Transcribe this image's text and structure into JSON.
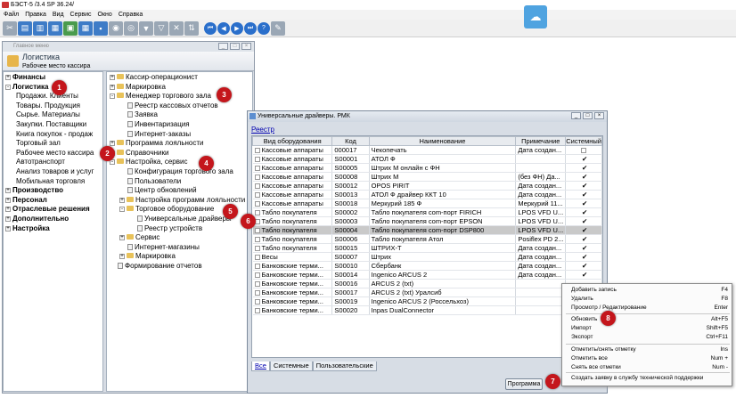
{
  "window": {
    "title": "БЭСТ-5 /3.4 SP 36.24/"
  },
  "menu": [
    "Файл",
    "Правка",
    "Вид",
    "Сервис",
    "Окно",
    "Справка"
  ],
  "main_window": {
    "caption": "Главное меню",
    "title": "Логистика",
    "subtitle": "Рабочее место кассира"
  },
  "left_tree": [
    {
      "label": "Финансы",
      "bold": true,
      "exp": "+"
    },
    {
      "label": "Логистика",
      "bold": true,
      "exp": "-"
    },
    {
      "label": "Продажи. Клиенты",
      "bold": false,
      "exp": ""
    },
    {
      "label": "Товары. Продукция",
      "bold": false,
      "exp": ""
    },
    {
      "label": "Сырье. Материалы",
      "bold": false,
      "exp": ""
    },
    {
      "label": "Закупки. Поставщики",
      "bold": false,
      "exp": ""
    },
    {
      "label": "Книга покупок - продаж",
      "bold": false,
      "exp": ""
    },
    {
      "label": "Торговый зал",
      "bold": false,
      "exp": ""
    },
    {
      "label": "Рабочее место кассира",
      "bold": false,
      "exp": ""
    },
    {
      "label": "Автотранспорт",
      "bold": false,
      "exp": ""
    },
    {
      "label": "Анализ товаров и услуг",
      "bold": false,
      "exp": ""
    },
    {
      "label": "Мобильная торговля",
      "bold": false,
      "exp": ""
    },
    {
      "label": "Производство",
      "bold": true,
      "exp": "+"
    },
    {
      "label": "Персонал",
      "bold": true,
      "exp": "+"
    },
    {
      "label": "Отраслевые решения",
      "bold": true,
      "exp": "+"
    },
    {
      "label": "Дополнительно",
      "bold": true,
      "exp": "+"
    },
    {
      "label": "Настройка",
      "bold": true,
      "exp": "+"
    }
  ],
  "mid_tree": [
    {
      "label": "Кассир-операционист",
      "type": "folder",
      "exp": "+",
      "level": 0
    },
    {
      "label": "Маркировка",
      "type": "folder",
      "exp": "+",
      "level": 0
    },
    {
      "label": "Менеджер торгового зала",
      "type": "folder",
      "exp": "-",
      "level": 0
    },
    {
      "label": "Реестр кассовых отчетов",
      "type": "doc",
      "exp": "",
      "level": 1
    },
    {
      "label": "Заявка",
      "type": "doc",
      "exp": "",
      "level": 1
    },
    {
      "label": "Инвентаризация",
      "type": "doc",
      "exp": "",
      "level": 1
    },
    {
      "label": "Интернет-заказы",
      "type": "doc",
      "exp": "",
      "level": 1
    },
    {
      "label": "Программа лояльности",
      "type": "folder",
      "exp": "+",
      "level": 0
    },
    {
      "label": "Справочники",
      "type": "folder",
      "exp": "+",
      "level": 0
    },
    {
      "label": "Настройка, сервис",
      "type": "folder",
      "exp": "-",
      "level": 0
    },
    {
      "label": "Конфигурация торгового зала",
      "type": "doc",
      "exp": "",
      "level": 1
    },
    {
      "label": "Пользователи",
      "type": "doc",
      "exp": "",
      "level": 1
    },
    {
      "label": "Центр обновлений",
      "type": "doc",
      "exp": "",
      "level": 1
    },
    {
      "label": "Настройка программ лояльности",
      "type": "folder",
      "exp": "+",
      "level": 1
    },
    {
      "label": "Торговое оборудование",
      "type": "folder",
      "exp": "-",
      "level": 1
    },
    {
      "label": "Универсальные драйверы",
      "type": "doc",
      "exp": "",
      "level": 2
    },
    {
      "label": "Реестр устройств",
      "type": "doc",
      "exp": "",
      "level": 2
    },
    {
      "label": "Сервис",
      "type": "folder",
      "exp": "+",
      "level": 1
    },
    {
      "label": "Интернет-магазины",
      "type": "doc",
      "exp": "",
      "level": 1
    },
    {
      "label": "Маркировка",
      "type": "folder",
      "exp": "+",
      "level": 1
    },
    {
      "label": "Формирование отчетов",
      "type": "doc",
      "exp": "",
      "level": 0
    }
  ],
  "dialog": {
    "title": "Универсальные драйверы. РМК",
    "tab": "Реестр",
    "columns": [
      "Вид оборудования",
      "Код",
      "Наименование",
      "Примечание",
      "Системный"
    ],
    "rows": [
      [
        "Кассовые аппараты",
        "000017",
        "Чекопечать",
        "Дата создан...",
        "no"
      ],
      [
        "Кассовые аппараты",
        "S00001",
        "АТОЛ Ф",
        "",
        "yes"
      ],
      [
        "Кассовые аппараты",
        "S00005",
        "Штрих М онлайн с ФН",
        "",
        "yes"
      ],
      [
        "Кассовые аппараты",
        "S00008",
        "Штрих М",
        "(без ФН) Да...",
        "yes"
      ],
      [
        "Кассовые аппараты",
        "S00012",
        "OPOS PIRIT",
        "Дата создан...",
        "yes"
      ],
      [
        "Кассовые аппараты",
        "S00013",
        "АТОЛ Ф драйвер ККТ 10",
        "Дата создан...",
        "yes"
      ],
      [
        "Кассовые аппараты",
        "S00018",
        "Меркурий 185 Ф",
        "Меркурий 11...",
        "yes"
      ],
      [
        "Табло покупателя",
        "S00002",
        "Табло покупателя com-порт FIRICH",
        "LPOS VFD U...",
        "yes"
      ],
      [
        "Табло покупателя",
        "S00003",
        "Табло покупателя com-порт EPSON",
        "LPOS VFD U...",
        "yes"
      ],
      [
        "Табло покупателя",
        "S00004",
        "Табло покупателя com-порт DSP800",
        "LPOS VFD U...",
        "yes"
      ],
      [
        "Табло покупателя",
        "S00006",
        "Табло покупателя Атол",
        "Posiflex PD 2...",
        "yes"
      ],
      [
        "Табло покупателя",
        "S00015",
        "ШТРИХ-Т",
        "Дата создан...",
        "yes"
      ],
      [
        "Весы",
        "S00007",
        "Штрих",
        "Дата создан...",
        "yes"
      ],
      [
        "Банковские терми...",
        "S00010",
        "Сбербанк",
        "Дата создан...",
        "yes"
      ],
      [
        "Банковские терми...",
        "S00014",
        "Ingenico ARCUS 2",
        "Дата создан...",
        "yes"
      ],
      [
        "Банковские терми...",
        "S00016",
        "ARCUS 2 (txt)",
        "",
        ""
      ],
      [
        "Банковские терми...",
        "S00017",
        "ARCUS 2 (txt) Уралсиб",
        "",
        ""
      ],
      [
        "Банковские терми...",
        "S00019",
        "Ingenico ARCUS 2 (Россельхоз)",
        "",
        ""
      ],
      [
        "Банковские терми...",
        "S00020",
        "Inpas DualConnector",
        "",
        ""
      ]
    ],
    "selected_row": 9,
    "bottom_tabs": [
      "Все",
      "Системные",
      "Пользовательские"
    ],
    "program_button": "Программа"
  },
  "context_menu": [
    {
      "label": "Добавить запись",
      "key": "F4"
    },
    {
      "label": "Удалить",
      "key": "F8"
    },
    {
      "label": "Просмотр / Редактирование",
      "key": "Enter"
    },
    {
      "label": "Обновить",
      "key": "Alt+F5"
    },
    {
      "label": "Импорт",
      "key": "Shift+F5"
    },
    {
      "label": "Экспорт",
      "key": "Ctrl+F11"
    },
    {
      "label": "Отметить/снять отметку",
      "key": "Ins"
    },
    {
      "label": "Отметить все",
      "key": "Num +"
    },
    {
      "label": "Снять все отметки",
      "key": "Num -"
    },
    {
      "label": "Создать заявку в службу технической поддержки",
      "key": ""
    }
  ],
  "badges": [
    "1",
    "2",
    "3",
    "4",
    "5",
    "6",
    "7",
    "8"
  ],
  "icons": [
    "cloud-upload-icon"
  ]
}
